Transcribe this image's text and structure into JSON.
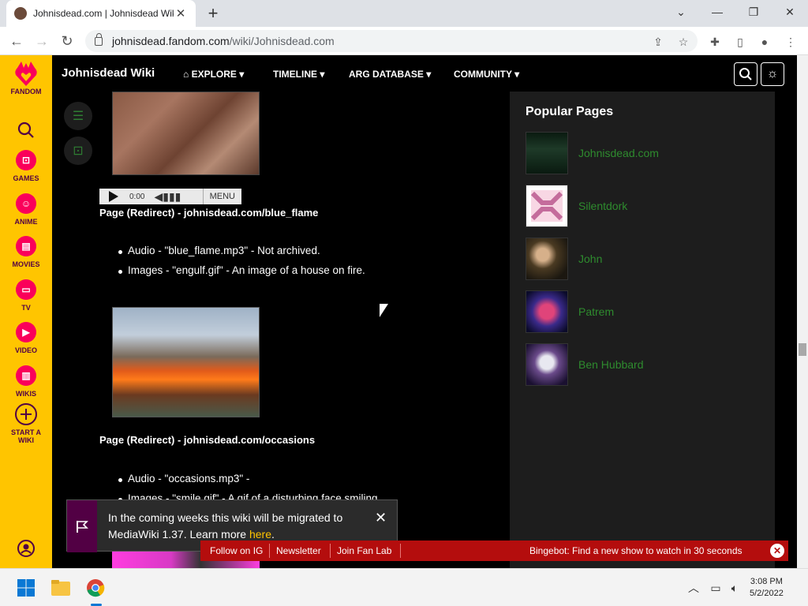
{
  "browser": {
    "tab_title": "Johnisdead.com | Johnisdead Wiki",
    "url_host": "johnisdead.fandom.com",
    "url_path": "/wiki/Johnisdead.com",
    "tab_close": "✕",
    "new_tab": "+"
  },
  "fandom_bar": {
    "logo_label": "FANDOM",
    "items": [
      {
        "label": "GAMES",
        "icon": "gamepad-icon"
      },
      {
        "label": "ANIME",
        "icon": "anime-icon"
      },
      {
        "label": "MOVIES",
        "icon": "movie-icon"
      },
      {
        "label": "TV",
        "icon": "tv-icon"
      },
      {
        "label": "VIDEO",
        "icon": "video-icon"
      },
      {
        "label": "WIKIS",
        "icon": "book-icon"
      }
    ],
    "start_wiki_1": "START A",
    "start_wiki_2": "WIKI"
  },
  "wiki_header": {
    "title": "Johnisdead Wiki",
    "nav": [
      "EXPLORE",
      "TIMELINE",
      "ARG DATABASE",
      "COMMUNITY"
    ]
  },
  "content": {
    "audio_time": "0:00",
    "audio_menu": "MENU",
    "section1_title": "Page (Redirect) - johnisdead.com/blue_flame",
    "section1_items": [
      "Audio - \"blue_flame.mp3\" - Not archived.",
      "Images - \"engulf.gif\" - An image of a house on fire."
    ],
    "section2_title": "Page (Redirect) - johnisdead.com/occasions",
    "section2_items": [
      "Audio - \"occasions.mp3\" -",
      "Images - \"smile.gif\" - A gif of a disturbing face smiling."
    ]
  },
  "rail": {
    "heading": "Popular Pages",
    "pages": [
      "Johnisdead.com",
      "Silentdork",
      "John",
      "Patrem",
      "Ben Hubbard"
    ]
  },
  "toast": {
    "text": "In the coming weeks this wiki will be migrated to MediaWiki 1.37. Learn more ",
    "link": "here",
    "tail": "."
  },
  "bottom_bar": {
    "links": [
      "Follow on IG",
      "Newsletter",
      "Join Fan Lab"
    ],
    "bingebot": "Bingebot: Find a new show to watch in 30 seconds"
  },
  "taskbar": {
    "time": "3:08 PM",
    "date": "5/2/2022"
  },
  "colors": {
    "fandom_yellow": "#ffc500",
    "link_green": "#2e8b2e",
    "bar_red": "#b40d0d"
  }
}
